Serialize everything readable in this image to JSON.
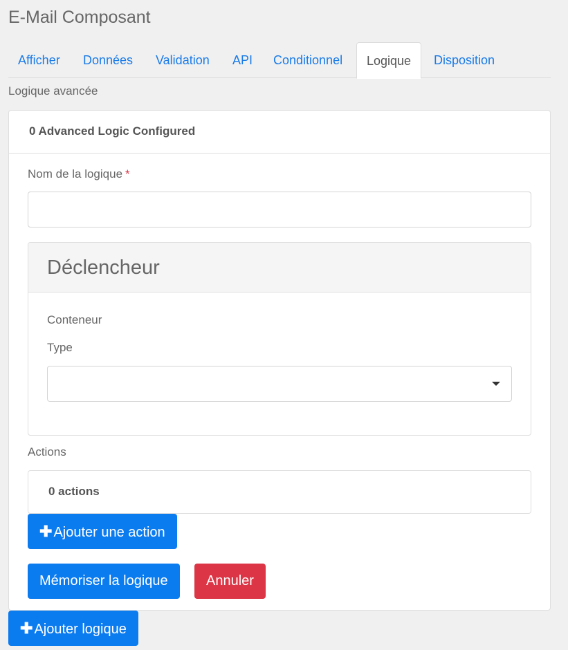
{
  "page": {
    "title": "E-Mail Composant"
  },
  "tabs": [
    {
      "label": "Afficher"
    },
    {
      "label": "Données"
    },
    {
      "label": "Validation"
    },
    {
      "label": "API"
    },
    {
      "label": "Conditionnel"
    },
    {
      "label": "Logique"
    },
    {
      "label": "Disposition"
    }
  ],
  "active_tab": "Logique",
  "section": {
    "label": "Logique avancée"
  },
  "logic_card": {
    "header": "0 Advanced Logic Configured",
    "name_label": "Nom de la logique",
    "required_mark": "*",
    "name_value": "",
    "trigger": {
      "title": "Déclencheur",
      "container_label": "Conteneur",
      "type_label": "Type",
      "type_value": ""
    },
    "actions_label": "Actions",
    "actions_count": "0 actions",
    "add_action_label": "Ajouter une action",
    "save_label": "Mémoriser la logique",
    "cancel_label": "Annuler"
  },
  "add_logic_label": "Ajouter logique",
  "colors": {
    "primary": "#0b7bf0",
    "danger": "#dc3545",
    "tab_link": "#1a7be8"
  },
  "icons": {
    "plus": "plus-icon",
    "dropdown": "chevron-down-icon"
  }
}
